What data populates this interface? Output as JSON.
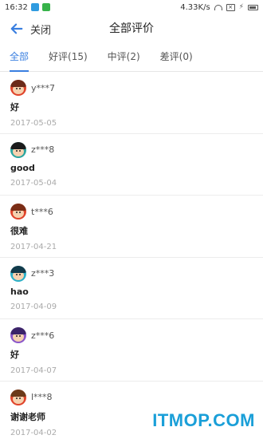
{
  "status_bar": {
    "time": "16:32",
    "speed": "4.33K/s"
  },
  "header": {
    "back_label": "关闭",
    "title": "全部评价"
  },
  "tabs": [
    {
      "label": "全部",
      "active": true
    },
    {
      "label": "好评(15)",
      "active": false
    },
    {
      "label": "中评(2)",
      "active": false
    },
    {
      "label": "差评(0)",
      "active": false
    }
  ],
  "reviews": [
    {
      "user": "y***7",
      "text": "好",
      "date": "2017-05-05",
      "avatar_ring": "#e0442b",
      "avatar_hair": "#6b2b1a"
    },
    {
      "user": "z***8",
      "text": "good",
      "date": "2017-05-04",
      "avatar_ring": "#2ba6a0",
      "avatar_hair": "#1b1b1b"
    },
    {
      "user": "t***6",
      "text": "很难",
      "date": "2017-04-21",
      "avatar_ring": "#e0442b",
      "avatar_hair": "#7a2d16"
    },
    {
      "user": "z***3",
      "text": "hao",
      "date": "2017-04-09",
      "avatar_ring": "#2bb0c7",
      "avatar_hair": "#123a4a"
    },
    {
      "user": "z***6",
      "text": "好",
      "date": "2017-04-07",
      "avatar_ring": "#8a56c9",
      "avatar_hair": "#3b2468"
    },
    {
      "user": "l***8",
      "text": "谢谢老师",
      "date": "2017-04-02",
      "avatar_ring": "#e0442b",
      "avatar_hair": "#6b3a1a"
    }
  ],
  "watermark": "ITMOP.COM",
  "colors": {
    "accent": "#3a7fe0",
    "divider": "#ececec",
    "date": "#aaaaaa"
  }
}
